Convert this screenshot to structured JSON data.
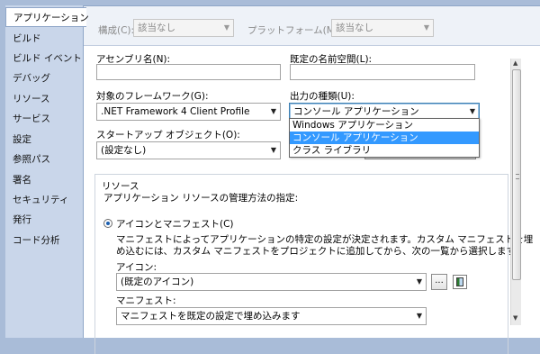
{
  "tabs": [
    {
      "label": "アプリケーション",
      "active": true
    },
    {
      "label": "ビルド"
    },
    {
      "label": "ビルド イベント"
    },
    {
      "label": "デバッグ"
    },
    {
      "label": "リソース"
    },
    {
      "label": "サービス"
    },
    {
      "label": "設定"
    },
    {
      "label": "参照パス"
    },
    {
      "label": "署名"
    },
    {
      "label": "セキュリティ"
    },
    {
      "label": "発行"
    },
    {
      "label": "コード分析"
    }
  ],
  "topbar": {
    "config_label": "構成(C):",
    "config_value": "該当なし",
    "platform_label": "プラットフォーム(M):",
    "platform_value": "該当なし"
  },
  "form": {
    "assembly_label": "アセンブリ名(N):",
    "assembly_value": "",
    "namespace_label": "既定の名前空間(L):",
    "namespace_value": "",
    "framework_label": "対象のフレームワーク(G):",
    "framework_value": ".NET Framework 4 Client Profile",
    "output_label": "出力の種類(U):",
    "output_value": "コンソール アプリケーション",
    "startup_label": "スタートアップ オブジェクト(O):",
    "startup_value": "(設定なし)"
  },
  "output_options": [
    "Windows アプリケーション",
    "コンソール アプリケーション",
    "クラス ライブラリ"
  ],
  "resources": {
    "group_title": "リソース",
    "desc": "アプリケーション リソースの管理方法の指定:",
    "radio_label": "アイコンとマニフェスト(C)",
    "radio_desc_1": "マニフェストによってアプリケーションの特定の設定が決定されます。カスタム マニフェストを埋",
    "radio_desc_2": "め込むには、カスタム マニフェストをプロジェクトに追加してから、次の一覧から選択します。",
    "icon_label": "アイコン:",
    "icon_value": "(既定のアイコン)",
    "browse_label": "...",
    "manifest_label": "マニフェスト:",
    "manifest_value": "マニフェストを既定の設定で埋め込みます"
  }
}
